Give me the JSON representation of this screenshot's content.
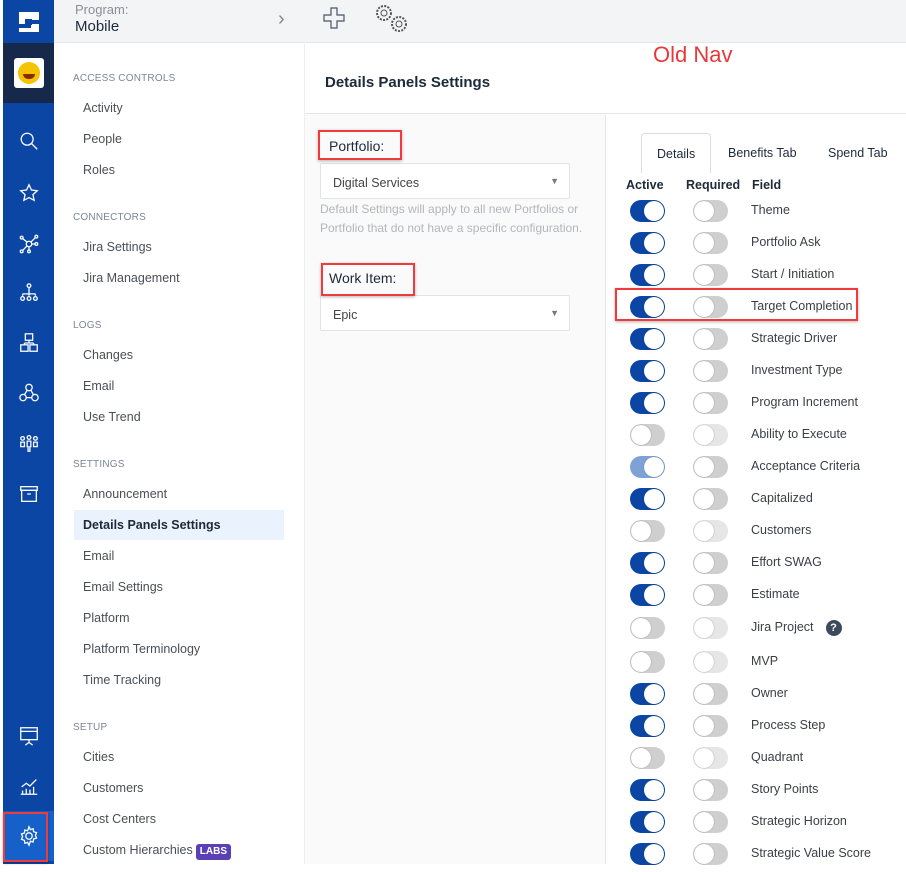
{
  "topbar": {
    "program_label": "Program:",
    "program_value": "Mobile"
  },
  "annotation": "Old Nav",
  "sidebar": {
    "sections": [
      {
        "title": "ACCESS CONTROLS",
        "items": [
          "Activity",
          "People",
          "Roles"
        ]
      },
      {
        "title": "CONNECTORS",
        "items": [
          "Jira Settings",
          "Jira Management"
        ]
      },
      {
        "title": "LOGS",
        "items": [
          "Changes",
          "Email",
          "Use Trend"
        ]
      },
      {
        "title": "SETTINGS",
        "items": [
          "Announcement",
          "Details Panels Settings",
          "Email",
          "Email Settings",
          "Platform",
          "Platform Terminology",
          "Time Tracking"
        ]
      },
      {
        "title": "SETUP",
        "items": [
          "Cities",
          "Customers",
          "Cost Centers",
          "Custom Hierarchies"
        ]
      }
    ],
    "active": "Details Panels Settings",
    "labs_badge": "LABS"
  },
  "main": {
    "title": "Details Panels Settings",
    "portfolio_label": "Portfolio:",
    "portfolio_value": "Digital Services",
    "help": "Default Settings will apply to all new Portfolios or Portfolio that do not have a specific configuration.",
    "work_item_label": "Work Item:",
    "work_item_value": "Epic"
  },
  "panel": {
    "tabs": [
      "Details",
      "Benefits Tab",
      "Spend Tab"
    ],
    "selected_tab": "Details",
    "columns": [
      "Active",
      "Required",
      "Field"
    ],
    "rows": [
      {
        "field": "Theme",
        "active": "on",
        "required": "off"
      },
      {
        "field": "Portfolio Ask",
        "active": "on",
        "required": "off"
      },
      {
        "field": "Start / Initiation",
        "active": "on",
        "required": "off"
      },
      {
        "field": "Target Completion",
        "active": "on",
        "required": "off"
      },
      {
        "field": "Strategic Driver",
        "active": "on",
        "required": "off"
      },
      {
        "field": "Investment Type",
        "active": "on",
        "required": "off"
      },
      {
        "field": "Program Increment",
        "active": "on",
        "required": "off"
      },
      {
        "field": "Ability to Execute",
        "active": "off",
        "required": "disabled"
      },
      {
        "field": "Acceptance Criteria",
        "active": "on-disabled",
        "required": "off"
      },
      {
        "field": "Capitalized",
        "active": "on",
        "required": "off"
      },
      {
        "field": "Customers",
        "active": "off",
        "required": "disabled"
      },
      {
        "field": "Effort SWAG",
        "active": "on",
        "required": "off"
      },
      {
        "field": "Estimate",
        "active": "on",
        "required": "off"
      },
      {
        "field": "Jira Project",
        "active": "off",
        "required": "disabled",
        "help": "?"
      },
      {
        "field": "MVP",
        "active": "off",
        "required": "disabled"
      },
      {
        "field": "Owner",
        "active": "on",
        "required": "off"
      },
      {
        "field": "Process Step",
        "active": "on",
        "required": "off"
      },
      {
        "field": "Quadrant",
        "active": "off",
        "required": "disabled"
      },
      {
        "field": "Story Points",
        "active": "on",
        "required": "off"
      },
      {
        "field": "Strategic Horizon",
        "active": "on",
        "required": "off"
      },
      {
        "field": "Strategic Value Score",
        "active": "on",
        "required": "off"
      }
    ]
  }
}
